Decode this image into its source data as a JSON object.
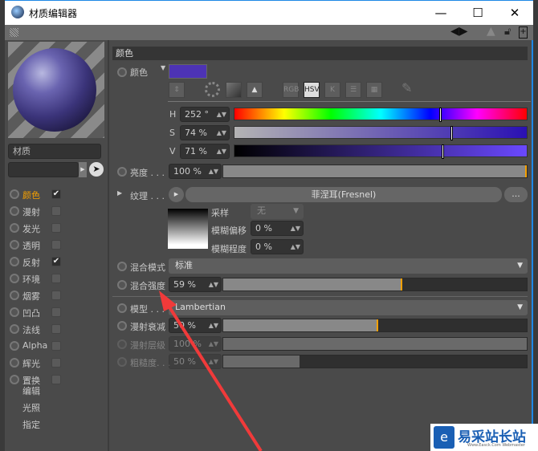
{
  "window": {
    "title": "材质编辑器",
    "minimize": "—",
    "maximize": "☐",
    "close": "✕"
  },
  "preview": {
    "name": "材质"
  },
  "channels": [
    {
      "label": "颜色",
      "checked": true,
      "active": true
    },
    {
      "label": "漫射",
      "checked": false
    },
    {
      "label": "发光",
      "checked": false
    },
    {
      "label": "透明",
      "checked": false
    },
    {
      "label": "反射",
      "checked": true
    },
    {
      "label": "环境",
      "checked": false
    },
    {
      "label": "烟雾",
      "checked": false
    },
    {
      "label": "凹凸",
      "checked": false
    },
    {
      "label": "法线",
      "checked": false
    },
    {
      "label": "Alpha",
      "checked": false
    },
    {
      "label": "辉光",
      "checked": false
    },
    {
      "label": "置换",
      "checked": false
    }
  ],
  "extra": [
    "编辑",
    "光照",
    "指定"
  ],
  "section": "颜色",
  "color": {
    "label": "颜色",
    "swatch": "#4d33b5",
    "modes": [
      "RGB",
      "HSV",
      "K"
    ],
    "active_mode": "HSV",
    "H": {
      "label": "H",
      "value": "252 °",
      "pos": 0.7
    },
    "S": {
      "label": "S",
      "value": "74 %",
      "pos": 0.74
    },
    "V": {
      "label": "V",
      "value": "71 %",
      "pos": 0.71
    }
  },
  "brightness": {
    "label": "亮度 . . .",
    "value": "100 %",
    "fill": 1.0
  },
  "texture": {
    "label": "纹理 . . .",
    "name": "菲涅耳(Fresnel)",
    "more": "...",
    "sampling": {
      "label": "采样",
      "value": "无"
    },
    "blur_offset": {
      "label": "模糊偏移",
      "value": "0 %"
    },
    "blur_scale": {
      "label": "模糊程度",
      "value": "0 %"
    }
  },
  "mix_mode": {
    "label": "混合模式",
    "value": "标准"
  },
  "mix_strength": {
    "label": "混合强度",
    "value": "59 %",
    "fill": 0.59
  },
  "model": {
    "label": "模型 . . .",
    "value": "Lambertian"
  },
  "diffuse_falloff": {
    "label": "漫射衰减",
    "value": "50 %",
    "fill": 0.51
  },
  "diffuse_level": {
    "label": "漫射层级",
    "value": "100 %",
    "fill": 1.0
  },
  "roughness": {
    "label": "粗糙度. . .",
    "value": "50 %",
    "fill": 0.25
  },
  "watermark": {
    "text": "易采站长站",
    "sub": "Www.Easck.Com Webmaster"
  }
}
